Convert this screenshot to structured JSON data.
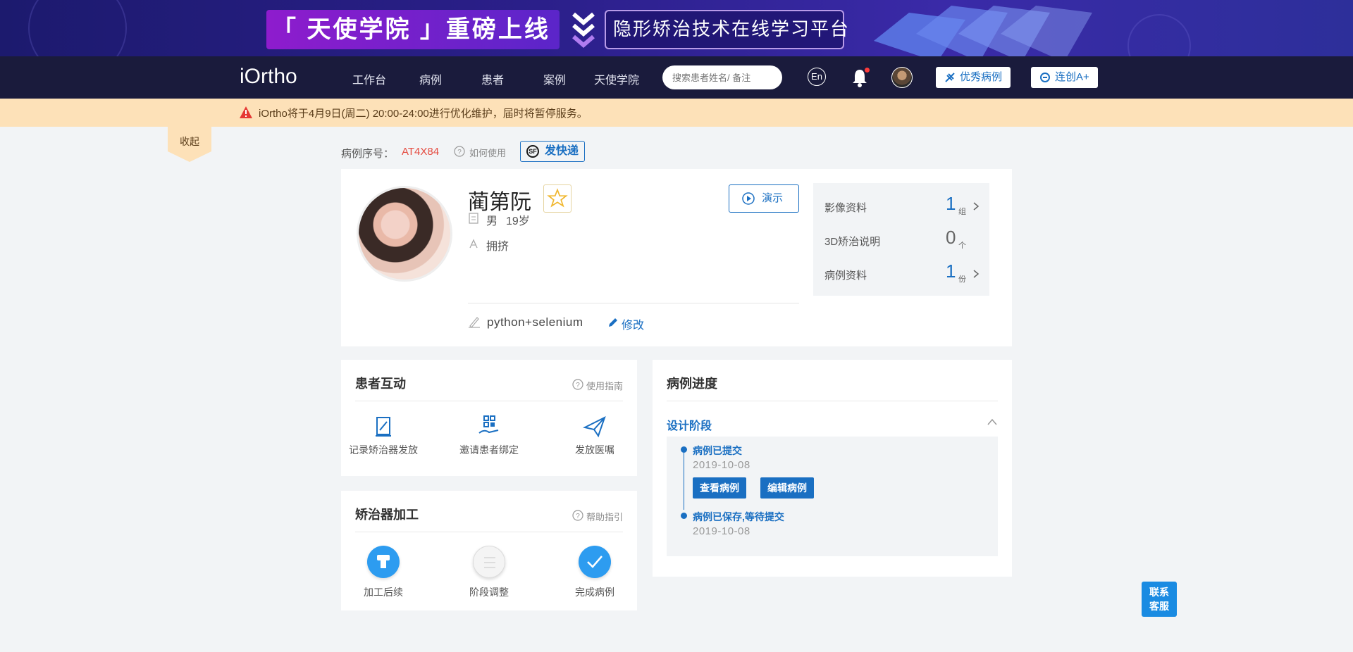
{
  "banner": {
    "left_text": "「 天使学院 」重磅上线",
    "right_text": "隐形矫治技术在线学习平台"
  },
  "nav": {
    "logo": "iOrtho",
    "items": [
      "工作台",
      "病例",
      "患者",
      "案例",
      "天使学院"
    ],
    "search_placeholder": "搜索患者姓名/ 备注",
    "lang": "En",
    "btn_excellent": "优秀病例",
    "btn_lianchuang": "连创A+"
  },
  "notice": {
    "text": "iOrtho将于4月9日(周二) 20:00-24:00进行优化维护，届时将暂停服务。",
    "collapse": "收起"
  },
  "case": {
    "label": "病例序号：",
    "id": "AT4X84",
    "help": "如何使用",
    "sf_button": "发快递"
  },
  "patient": {
    "name": "蔺第阮",
    "gender": "男",
    "age": "19岁",
    "condition": "拥挤",
    "note": "python+selenium",
    "edit": "修改",
    "demo": "演示"
  },
  "stats": [
    {
      "label": "影像资料",
      "value": "1",
      "unit": "组"
    },
    {
      "label": "3D矫治说明",
      "value": "0",
      "unit": "个"
    },
    {
      "label": "病例资料",
      "value": "1",
      "unit": "份"
    }
  ],
  "interact": {
    "title": "患者互动",
    "help": "使用指南",
    "actions": [
      "记录矫治器发放",
      "邀请患者绑定",
      "发放医嘱"
    ]
  },
  "processing": {
    "title": "矫治器加工",
    "help": "帮助指引",
    "actions": [
      "加工后续",
      "阶段调整",
      "完成病例"
    ]
  },
  "progress": {
    "title": "病例进度",
    "stage": "设计阶段",
    "events": [
      {
        "title": "病例已提交",
        "date": "2019-10-08"
      },
      {
        "title": "病例已保存,等待提交",
        "date": "2019-10-08"
      }
    ],
    "btn_view": "查看病例",
    "btn_edit": "编辑病例"
  },
  "service": {
    "line1": "联系",
    "line2": "客服"
  },
  "colors": {
    "accent": "#1a6fc2",
    "nav_bg": "#1a1b3c",
    "notice_bg": "#fde1b8",
    "case_id": "#e54d42"
  }
}
